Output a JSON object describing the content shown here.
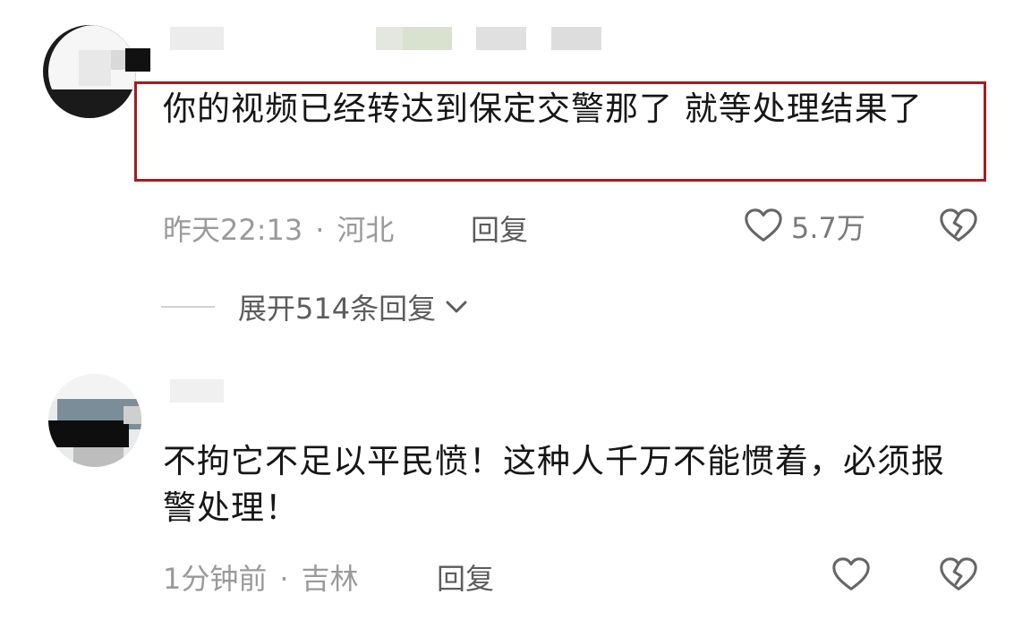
{
  "comments": [
    {
      "text": "你的视频已经转达到保定交警那了  就等处理结果了",
      "time": "昨天22:13",
      "separator": "·",
      "location": "河北",
      "reply_label": "回复",
      "like_count": "5.7万",
      "expand_label": "展开514条回复",
      "highlight_color": "#a51d1d"
    },
    {
      "text": "不拘它不足以平民愤！这种人千万不能惯着，必须报警处理！",
      "time": "1分钟前",
      "separator": "·",
      "location": "吉林",
      "reply_label": "回复"
    }
  ],
  "icons": {
    "like": "heart-outline-icon",
    "dislike": "broken-heart-icon",
    "expand": "chevron-down-icon"
  }
}
